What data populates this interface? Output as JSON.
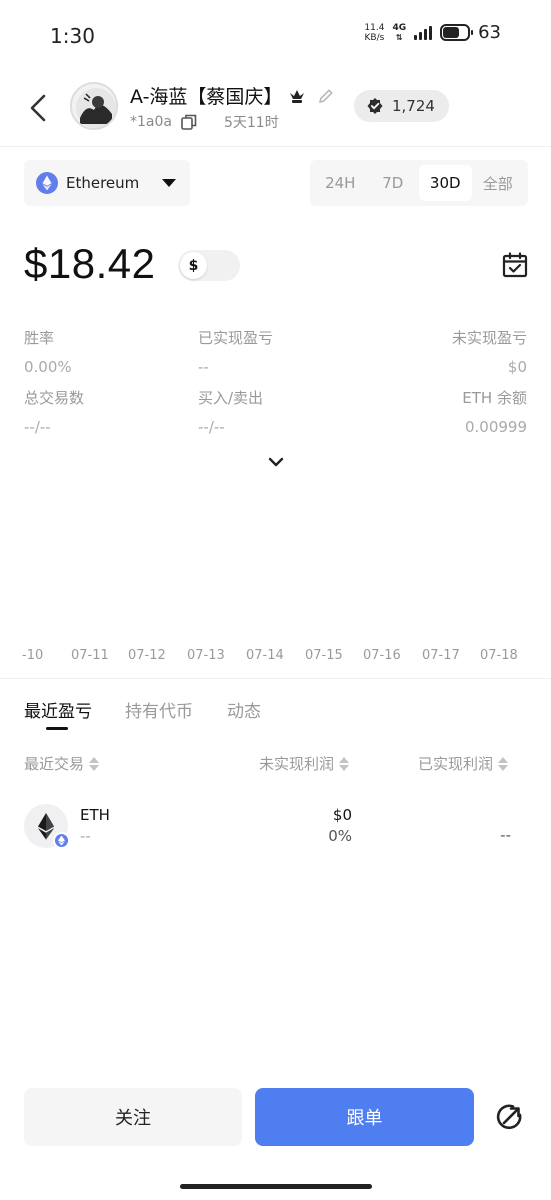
{
  "status_bar": {
    "time": "1:30",
    "speed_value": "11.4",
    "speed_unit": "KB/s",
    "network": "4G",
    "battery": "63"
  },
  "header": {
    "name": "A-海蓝【蔡国庆】",
    "address": "*1a0a",
    "age": "5天11时",
    "followers": "1,724"
  },
  "chain": {
    "label": "Ethereum"
  },
  "periods": [
    "24H",
    "7D",
    "30D",
    "全部"
  ],
  "active_period": "30D",
  "balance": {
    "amount": "$18.42",
    "currency_symbol": "$"
  },
  "stats": {
    "win_rate": {
      "label": "胜率",
      "value": "0.00%"
    },
    "realized_pnl": {
      "label": "已实现盈亏",
      "value": "--"
    },
    "unrealized_pnl": {
      "label": "未实现盈亏",
      "value": "$0"
    },
    "total_trades": {
      "label": "总交易数",
      "value": "--/--"
    },
    "buy_sell": {
      "label": "买入/卖出",
      "value": "--/--"
    },
    "eth_balance": {
      "label": "ETH 余额",
      "value": "0.00999"
    }
  },
  "chart": {
    "x_ticks": [
      "-10",
      "07-11",
      "07-12",
      "07-13",
      "07-14",
      "07-15",
      "07-16",
      "07-17",
      "07-18"
    ]
  },
  "tabs": [
    "最近盈亏",
    "持有代币",
    "动态"
  ],
  "table": {
    "headers": [
      "最近交易",
      "未实现利润",
      "已实现利润"
    ],
    "rows": [
      {
        "symbol": "ETH",
        "sub": "--",
        "unrealized_value": "$0",
        "unrealized_pct": "0%",
        "realized": "--"
      }
    ]
  },
  "actions": {
    "follow": "关注",
    "copy_trade": "跟单"
  },
  "colors": {
    "primary": "#4f7ef0",
    "eth": "#627eea"
  }
}
